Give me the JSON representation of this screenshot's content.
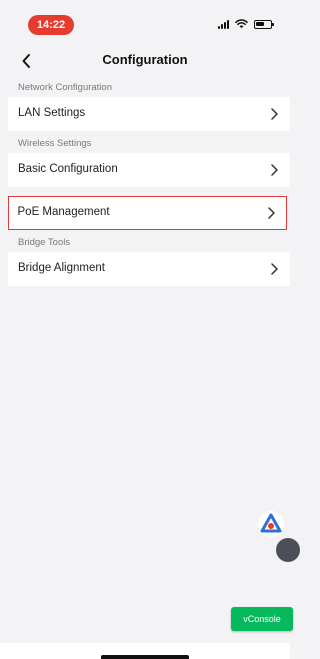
{
  "status_bar": {
    "time": "14:22"
  },
  "header": {
    "title": "Configuration"
  },
  "sections": [
    {
      "header": "Network Configuration",
      "items": [
        {
          "label": "LAN Settings"
        }
      ]
    },
    {
      "header": "Wireless Settings",
      "items": [
        {
          "label": "Basic Configuration"
        },
        {
          "label": "PoE Management",
          "selected": true
        }
      ]
    },
    {
      "header": "Bridge Tools",
      "items": [
        {
          "label": "Bridge Alignment"
        }
      ]
    }
  ],
  "vconsole": {
    "label": "vConsole"
  },
  "colors": {
    "background": "#f3f3f5",
    "time_pill": "#e53c2f",
    "selection_border": "#e0383c",
    "vconsole_bg": "#07b85c"
  }
}
